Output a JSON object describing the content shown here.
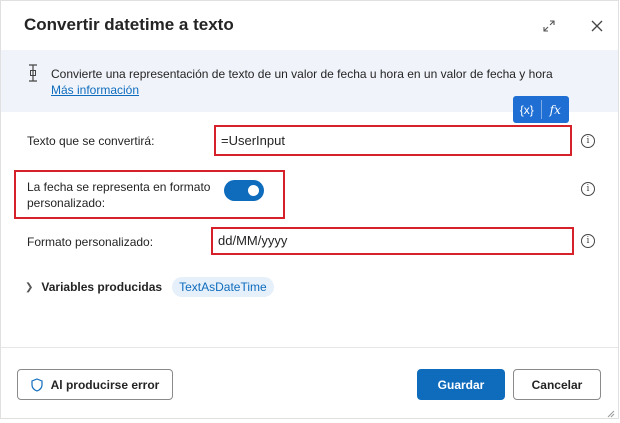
{
  "dialog": {
    "title": "Convertir datetime a texto"
  },
  "info": {
    "text": "Convierte una representación de texto de un valor de fecha u hora en un valor de fecha y hora",
    "link": "Más información"
  },
  "var_buttons": {
    "variable": "{x}",
    "function": "fx"
  },
  "fields": {
    "text_label": "Texto que se convertirá:",
    "text_value": "=UserInput",
    "custom_format_toggle_label_line1": "La fecha se representa en formato",
    "custom_format_toggle_label_line2": "personalizado:",
    "custom_format_toggle_state": true,
    "format_label": "Formato personalizado:",
    "format_value": "dd/MM/yyyy"
  },
  "variables": {
    "label": "Variables producidas",
    "chip": "TextAsDateTime"
  },
  "footer": {
    "error_button": "Al producirse error",
    "save_button": "Guardar",
    "cancel_button": "Cancelar"
  },
  "colors": {
    "accent": "#0f6cbd",
    "highlight": "#d6202a",
    "info_bg": "#f0f4fa"
  }
}
